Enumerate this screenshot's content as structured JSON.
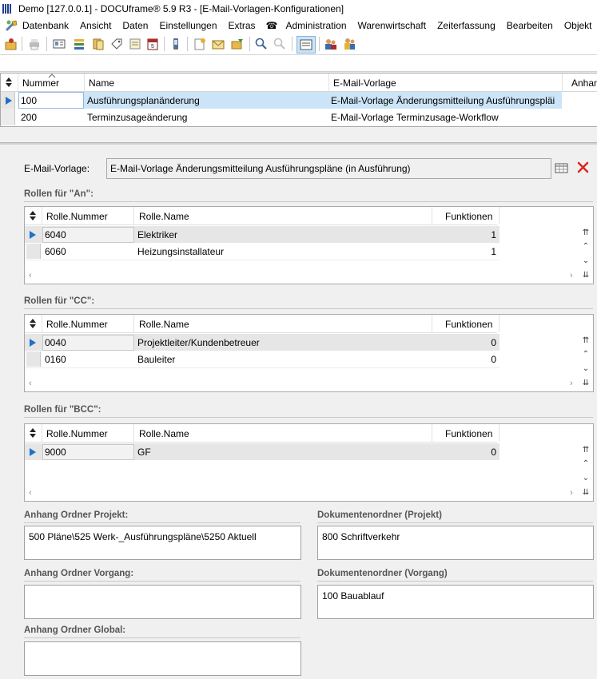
{
  "window": {
    "title": "Demo [127.0.0.1] - DOCUframe® 5.9 R3 - [E-Mail-Vorlagen-Konfigurationen]"
  },
  "menu": {
    "items": [
      "Datenbank",
      "Ansicht",
      "Daten",
      "Einstellungen",
      "Extras",
      "Administration",
      "Warenwirtschaft",
      "Zeiterfassung",
      "Bearbeiten",
      "Objekt"
    ]
  },
  "main_grid": {
    "columns": [
      "Nummer",
      "Name",
      "E-Mail-Vorlage",
      "Anhan"
    ],
    "rows": [
      {
        "nummer": "100",
        "name": "Ausführungsplanänderung",
        "vorlage": "E-Mail-Vorlage Änderungsmitteilung Ausführungspläi"
      },
      {
        "nummer": "200",
        "name": "Terminzusageänderung",
        "vorlage": "E-Mail-Vorlage Terminzusage-Workflow"
      }
    ]
  },
  "detail": {
    "vorlage_label": "E-Mail-Vorlage:",
    "vorlage_value": "E-Mail-Vorlage Änderungsmitteilung Ausführungspläne (in Ausführung)"
  },
  "roles_an": {
    "label": "Rollen für \"An\":",
    "columns": [
      "Rolle.Nummer",
      "Rolle.Name",
      "Funktionen"
    ],
    "rows": [
      {
        "nummer": "6040",
        "name": "Elektriker",
        "funktionen": "1"
      },
      {
        "nummer": "6060",
        "name": "Heizungsinstallateur",
        "funktionen": "1"
      }
    ]
  },
  "roles_cc": {
    "label": "Rollen für \"CC\":",
    "columns": [
      "Rolle.Nummer",
      "Rolle.Name",
      "Funktionen"
    ],
    "rows": [
      {
        "nummer": "0040",
        "name": "Projektleiter/Kundenbetreuer",
        "funktionen": "0"
      },
      {
        "nummer": "0160",
        "name": "Bauleiter",
        "funktionen": "0"
      }
    ]
  },
  "roles_bcc": {
    "label": "Rollen für \"BCC\":",
    "columns": [
      "Rolle.Nummer",
      "Rolle.Name",
      "Funktionen"
    ],
    "rows": [
      {
        "nummer": "9000",
        "name": "GF",
        "funktionen": "0"
      }
    ]
  },
  "folders": {
    "projekt_label": "Anhang Ordner Projekt:",
    "projekt_value": "500 Pläne\\525 Werk-_Ausführungspläne\\5250 Aktuell",
    "vorgang_label": "Anhang Ordner Vorgang:",
    "vorgang_value": "",
    "global_label": "Anhang Ordner Global:",
    "global_value": "",
    "dok_projekt_label": "Dokumentenordner (Projekt)",
    "dok_projekt_value": "800 Schriftverkehr",
    "dok_vorgang_label": "Dokumentenordner (Vorgang)",
    "dok_vorgang_value": "100 Bauablauf"
  },
  "colors": {
    "selection": "#cce4f7",
    "marker": "#1f72c6",
    "delete": "#d9261c"
  }
}
